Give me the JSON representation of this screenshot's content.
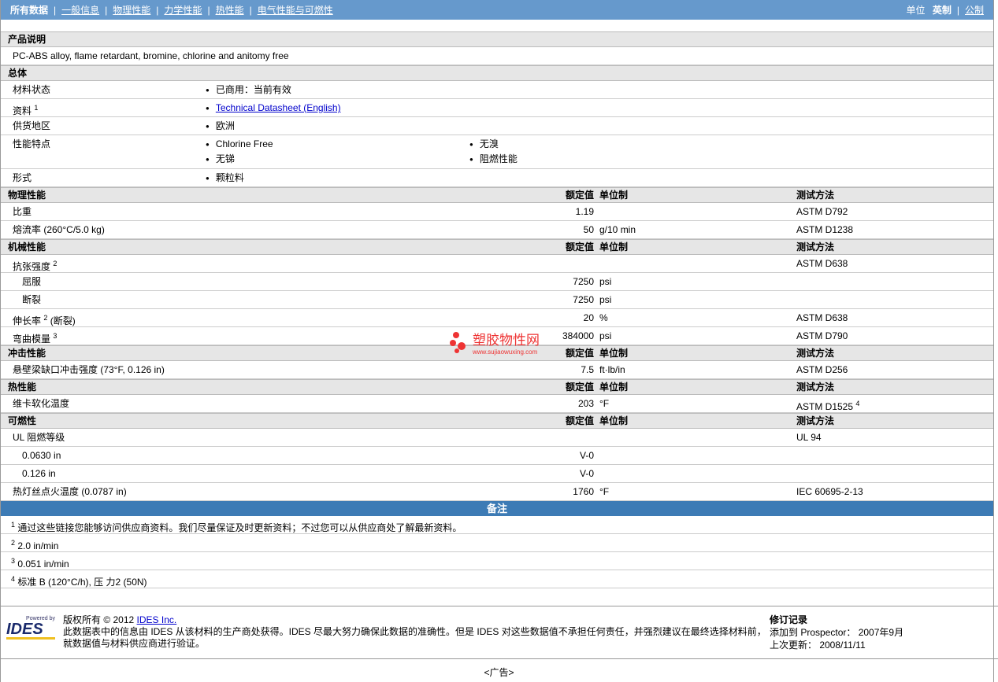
{
  "nav": {
    "items": [
      "所有数据",
      "一般信息",
      "物理性能",
      "力学性能",
      "热性能",
      "电气性能与可燃性"
    ],
    "unit_label": "单位",
    "imperial": "英制",
    "metric": "公制"
  },
  "product": {
    "title": "产品说明",
    "text": "PC-ABS alloy, flame retardant, bromine, chlorine and anitomy free"
  },
  "general": {
    "title": "总体",
    "rows": [
      {
        "label": "材料状态",
        "values": [
          "已商用：当前有效"
        ]
      },
      {
        "label": "资料",
        "sup": "1",
        "link": "Technical Datasheet (English)"
      },
      {
        "label": "供货地区",
        "values": [
          "欧洲"
        ]
      },
      {
        "label": "性能特点",
        "col1": [
          "Chlorine Free",
          "无锑"
        ],
        "col2": [
          "无溴",
          "阻燃性能"
        ]
      },
      {
        "label": "形式",
        "values": [
          "颗粒料"
        ]
      }
    ]
  },
  "headers": {
    "value": "额定值",
    "unit": "单位制",
    "test": "测试方法"
  },
  "sections": [
    {
      "title": "物理性能",
      "rows": [
        {
          "label": "比重",
          "value": "1.19",
          "unit": "",
          "test": "ASTM D792"
        },
        {
          "label": "熔流率  (260°C/5.0 kg)",
          "value": "50",
          "unit": "g/10 min",
          "test": "ASTM D1238"
        }
      ]
    },
    {
      "title": "机械性能",
      "rows": [
        {
          "label": "抗张强度",
          "sup": "2",
          "value": "",
          "unit": "",
          "test": "ASTM D638"
        },
        {
          "label": "屈服",
          "indent": true,
          "value": "7250",
          "unit": "psi",
          "test": ""
        },
        {
          "label": "断裂",
          "indent": true,
          "value": "7250",
          "unit": "psi",
          "test": ""
        },
        {
          "label": "伸长率",
          "sup": "2",
          "after": " (断裂)",
          "value": "20",
          "unit": "%",
          "test": "ASTM D638"
        },
        {
          "label": "弯曲模量",
          "sup": "3",
          "value": "384000",
          "unit": "psi",
          "test": "ASTM D790"
        }
      ]
    },
    {
      "title": "冲击性能",
      "rows": [
        {
          "label": "悬壁梁缺口冲击强度  (73°F, 0.126 in)",
          "value": "7.5",
          "unit": "ft·lb/in",
          "test": "ASTM D256"
        }
      ]
    },
    {
      "title": "热性能",
      "rows": [
        {
          "label": "维卡软化温度",
          "value": "203",
          "unit": "°F",
          "test": "ASTM D1525",
          "test_sup": "4"
        }
      ]
    },
    {
      "title": "可燃性",
      "rows": [
        {
          "label": "UL 阻燃等级",
          "value": "",
          "unit": "",
          "test": "UL 94"
        },
        {
          "label": "0.0630 in",
          "indent": true,
          "value": "V-0",
          "unit": "",
          "test": ""
        },
        {
          "label": "0.126 in",
          "indent": true,
          "value": "V-0",
          "unit": "",
          "test": ""
        },
        {
          "label": "热灯丝点火温度  (0.0787 in)",
          "value": "1760",
          "unit": "°F",
          "test": "IEC 60695-2-13"
        }
      ]
    }
  ],
  "notes": {
    "title": "备注",
    "items": [
      {
        "n": "1",
        "text": "通过这些链接您能够访问供应商资料。我们尽量保证及时更新资料；不过您可以从供应商处了解最新资料。"
      },
      {
        "n": "2",
        "text": "2.0 in/min"
      },
      {
        "n": "3",
        "text": "0.051 in/min"
      },
      {
        "n": "4",
        "text": "标准  B (120°C/h), 压  力2 (50N)"
      }
    ]
  },
  "footer": {
    "logo_small": "Powered by",
    "logo": "IDES",
    "copyright": "版权所有  © 2012 ",
    "company": "IDES Inc.",
    "disclaimer1": "此数据表中的信息由  IDES 从该材料的生产商处获得。IDES 尽最大努力确保此数据的准确性。但是  IDES 对这些数据值不承担任何责任，并强烈建议在最终选择材料前，",
    "disclaimer2": "就数据值与材料供应商进行验证。",
    "rev_title": "修订记录",
    "added": "添加到  Prospector：  2007年9月",
    "updated": "上次更新：  2008/11/11"
  },
  "ad": "<广告>",
  "watermark": {
    "name": "塑胶物性网",
    "url": "www.sujiaowuxing.com"
  }
}
